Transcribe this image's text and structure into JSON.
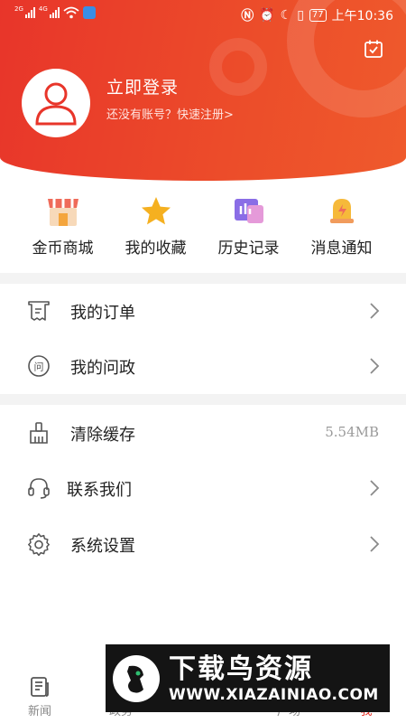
{
  "status_bar": {
    "sim1": "2G",
    "sim2": "4G",
    "battery": "77",
    "time": "上午10:36"
  },
  "profile": {
    "login_title": "立即登录",
    "register_prompt": "还没有账号？快速注册>"
  },
  "quick_actions": [
    {
      "label": "金币商城",
      "icon": "shop-icon"
    },
    {
      "label": "我的收藏",
      "icon": "star-icon"
    },
    {
      "label": "历史记录",
      "icon": "history-icon"
    },
    {
      "label": "消息通知",
      "icon": "bell-icon"
    }
  ],
  "menu": {
    "orders": "我的订单",
    "politics": "我的问政",
    "clear_cache": "清除缓存",
    "cache_size": "5.54MB",
    "contact": "联系我们",
    "settings": "系统设置"
  },
  "tabbar": {
    "news": "新闻",
    "politics": "政务",
    "square": "广场",
    "me": "我"
  },
  "watermark": {
    "title": "下载鸟资源",
    "url": "WWW.XIAZAINIAO.COM"
  },
  "colors": {
    "header": "#e8352a",
    "accent": "#e8352a"
  }
}
